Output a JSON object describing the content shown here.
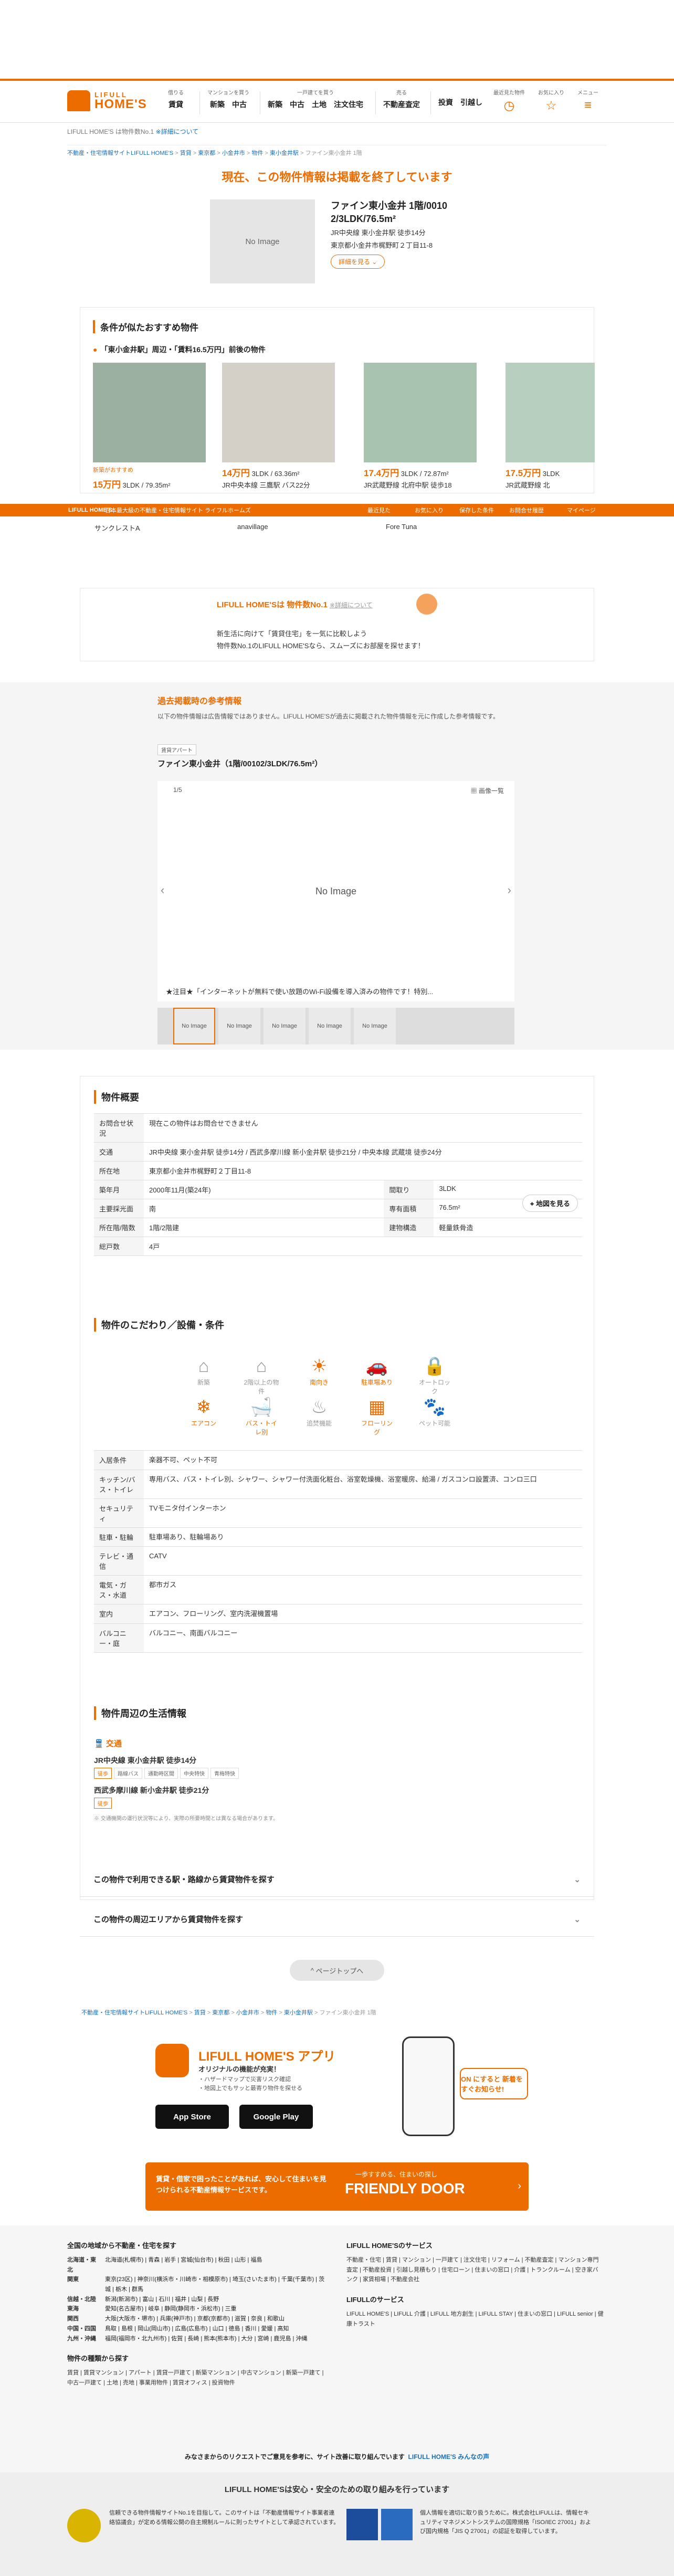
{
  "header": {
    "logo_top": "LIFULL",
    "logo_bottom": "HOME'S",
    "nav": [
      {
        "caption": "借りる",
        "links": [
          "賃貸"
        ]
      },
      {
        "caption": "マンションを買う",
        "links": [
          "新築",
          "中古"
        ]
      },
      {
        "caption": "一戸建てを買う",
        "links": [
          "新築",
          "中古",
          "土地",
          "注文住宅"
        ]
      },
      {
        "caption": "売る",
        "links": [
          "不動産査定"
        ]
      },
      {
        "caption": "",
        "links": [
          "投資",
          "引越し"
        ]
      }
    ],
    "right": [
      {
        "caption": "最近見た物件",
        "icon": "◷"
      },
      {
        "caption": "お気に入り",
        "icon": "☆"
      },
      {
        "caption": "メニュー",
        "icon": "≡"
      }
    ]
  },
  "crumb_top": {
    "site": "LIFULL HOME'S は物件数No.1",
    "about": "※詳細について"
  },
  "breadcrumb": [
    "不動産・住宅情報サイトLIFULL HOME'S",
    "賃貸",
    "東京都",
    "小金井市",
    "物件",
    "東小金井駅",
    "ファイン東小金井 1階"
  ],
  "ended": {
    "message": "現在、この物件情報は掲載を終了しています",
    "noimage": "No Image",
    "title": "ファイン東小金井 1階/0010 2/3LDK/76.5m²",
    "access": "JR中央線 東小金井駅 徒歩14分",
    "address": "東京都小金井市梶野町２丁目11-8",
    "detail_button": "詳細を見る"
  },
  "recommend": {
    "heading": "条件が似たおすすめ物件",
    "subheading": "「東小金井駅」周辺・「賃料16.5万円」前後の物件",
    "cards": [
      {
        "badge": "新築がおすすめ",
        "price": "15万円",
        "spec": "3LDK / 79.35m²",
        "station": "サンクレストA"
      },
      {
        "price": "14万円",
        "spec": "3LDK / 63.36m²",
        "station": "JR中央本線 三鷹駅 バス22分",
        "name": "anavillage"
      },
      {
        "price": "17.4万円",
        "spec": "3LDK / 72.87m²",
        "station": "JR武蔵野線 北府中駅 徒歩18",
        "name": "Fore Tuna"
      },
      {
        "price": "17.5万円",
        "spec": "3LDK",
        "station": "JR武蔵野線 北"
      }
    ]
  },
  "sticky_bar": {
    "brand": "LIFULL HOME'S",
    "tagline": "日本最大級の不動産・住宅情報サイト ライフルホームズ",
    "links": [
      "最近見た",
      "お気に入り",
      "保存した条件",
      "お問合せ履歴",
      "マイページ"
    ]
  },
  "no1": {
    "banner": "LIFULL HOME'Sは 物件数No.1",
    "banner_note": "※詳細について",
    "line1": "新生活に向けて「賃貸住宅」を一気に比較しよう",
    "line2": "物件数No.1のLIFULL HOME'Sなら、スムーズにお部屋を探せます！"
  },
  "history": {
    "heading": "過去掲載時の参考情報",
    "desc": "以下の物件情報は広告情報ではありません。LIFULL HOME'Sが過去に掲載された物件情報を元に作成した参考情報です。",
    "tag": "賃貸アパート",
    "name": "ファイン東小金井（1階/00102/3LDK/76.5m²）",
    "counter": "1/5",
    "all_images": "画像一覧",
    "noimage": "No Image",
    "caption": "★注目★「インターネットが無料で使い放題のWi-Fi設備を導入済みの物件です！特別...",
    "thumbs": [
      "No Image",
      "No Image",
      "No Image",
      "No Image",
      "No Image"
    ]
  },
  "summary": {
    "heading": "物件概要",
    "rows": [
      {
        "k": "お問合せ状況",
        "v": "現在この物件はお問合せできません"
      },
      {
        "k": "交通",
        "v": "JR中央線 東小金井駅 徒歩14分 / 西武多摩川線 新小金井駅 徒歩21分 / 中央本線 武蔵境 徒歩24分"
      },
      {
        "k": "所在地",
        "v": "東京都小金井市梶野町２丁目11-8"
      }
    ],
    "map_button": "地図を見る",
    "grid": [
      {
        "k1": "築年月",
        "v1": "2000年11月(築24年)",
        "k2": "間取り",
        "v2": "3LDK"
      },
      {
        "k1": "主要採光面",
        "v1": "南",
        "k2": "専有面積",
        "v2": "76.5m²"
      },
      {
        "k1": "所在階/階数",
        "v1": "1階/2階建",
        "k2": "建物構造",
        "v2": "軽量鉄骨造"
      },
      {
        "k1": "総戸数",
        "v1": "4戸",
        "k2": "",
        "v2": ""
      }
    ]
  },
  "features": {
    "heading": "物件のこだわり／設備・条件",
    "icons": [
      {
        "label": "新築",
        "glyph": "⌂",
        "on": false
      },
      {
        "label": "2階以上の物件",
        "glyph": "⌂",
        "on": false
      },
      {
        "label": "南向き",
        "glyph": "☀",
        "on": true
      },
      {
        "label": "駐車場あり",
        "glyph": "🚗",
        "on": true
      },
      {
        "label": "オートロック",
        "glyph": "🔒",
        "on": false
      },
      {
        "label": "エアコン",
        "glyph": "❄",
        "on": true
      },
      {
        "label": "バス・トイレ別",
        "glyph": "🛁",
        "on": true
      },
      {
        "label": "追焚機能",
        "glyph": "♨",
        "on": false
      },
      {
        "label": "フローリング",
        "glyph": "▦",
        "on": true
      },
      {
        "label": "ペット可能",
        "glyph": "🐾",
        "on": false
      }
    ],
    "rows": [
      {
        "k": "入居条件",
        "v": "楽器不可、ペット不可"
      },
      {
        "k": "キッチン/バス・トイレ",
        "v": "専用バス、バス・トイレ別、シャワー、シャワー付洗面化粧台、浴室乾燥機、浴室暖房、給湯 / ガスコンロ設置済、コンロ三口"
      },
      {
        "k": "セキュリティ",
        "v": "TVモニタ付インターホン"
      },
      {
        "k": "駐車・駐輪",
        "v": "駐車場あり、駐輪場あり"
      },
      {
        "k": "テレビ・通信",
        "v": "CATV"
      },
      {
        "k": "電気・ガス・水道",
        "v": "都市ガス"
      },
      {
        "k": "室内",
        "v": "エアコン、フローリング、室内洗濯機置場"
      },
      {
        "k": "バルコニー・庭",
        "v": "バルコニー、南面バルコニー"
      }
    ]
  },
  "life": {
    "heading": "物件周辺の生活情報",
    "traffic": "交通",
    "st1": "JR中央線 東小金井駅 徒歩14分",
    "st1_chips": [
      "徒歩",
      "路線バス",
      "通勤時区間",
      "中央特快",
      "青梅特快"
    ],
    "st2": "西武多摩川線 新小金井駅 徒歩21分",
    "st2_chips": [
      "徒歩"
    ],
    "note": "※ 交通機関の運行状況等により、実際の所要時間とは異なる場合があります。"
  },
  "accordions": [
    "この物件で利用できる駅・路線から賃貸物件を探す",
    "この物件の周辺エリアから賃貸物件を探す"
  ],
  "pagetop": "ページトップへ",
  "app": {
    "title": "LIFULL HOME'S アプリ",
    "sub": "オリジナルの機能が充実！",
    "b1": "・ハザードマップで災害リスク確認",
    "b2": "・地図上でもサッと最寄り物件を探せる",
    "ios": "App Store",
    "android": "Google Play",
    "bubble": "ON にすると 新着をすぐお知らせ!"
  },
  "fd": {
    "a": "賃貸・借家で困ったことがあれば、安心して住まいを見つけられる不動産情報サービスです。",
    "b": "一歩すすめる、住まいの探し",
    "c": "FRIENDLY DOOR"
  },
  "footer": {
    "h1": "全国の地域から不動産・住宅を探す",
    "regions": [
      {
        "k": "北海道・東北",
        "v": "北海道(札幌市) | 青森 | 岩手 | 宮城(仙台市) | 秋田 | 山形 | 福島"
      },
      {
        "k": "関東",
        "v": "東京(23区) | 神奈川(横浜市・川崎市・相模原市) | 埼玉(さいたま市) | 千葉(千葉市) | 茨城 | 栃木 | 群馬"
      },
      {
        "k": "信越・北陸",
        "v": "新潟(新潟市) | 富山 | 石川 | 福井 | 山梨 | 長野"
      },
      {
        "k": "東海",
        "v": "愛知(名古屋市) | 岐阜 | 静岡(静岡市・浜松市) | 三重"
      },
      {
        "k": "関西",
        "v": "大阪(大阪市・堺市) | 兵庫(神戸市) | 京都(京都市) | 滋賀 | 奈良 | 和歌山"
      },
      {
        "k": "中国・四国",
        "v": "鳥取 | 島根 | 岡山(岡山市) | 広島(広島市) | 山口 | 徳島 | 香川 | 愛媛 | 高知"
      },
      {
        "k": "九州・沖縄",
        "v": "福岡(福岡市・北九州市) | 佐賀 | 長崎 | 熊本(熊本市) | 大分 | 宮崎 | 鹿児島 | 沖縄"
      }
    ],
    "h2": "物件の種類から探す",
    "kinds": "賃貸 | 賃貸マンション | アパート | 賃貸一戸建て | 新築マンション | 中古マンション | 新築一戸建て | 中古一戸建て | 土地 | 売地 | 事業用物件 | 賃貸オフィス | 投資物件",
    "h3": "LIFULL HOME'Sのサービス",
    "services": "不動産・住宅 | 賃貸 | マンション | 一戸建て | 注文住宅 | リフォーム | 不動産査定 | マンション専門査定 | 不動産投資 | 引越し見積もり | 住宅ローン | 住まいの窓口 | 介護 | トランクルーム | 空き家バンク | 家賃相場 | 不動産会社",
    "h4": "LIFULLのサービス",
    "lifull": "LIFULL HOME'S | LIFULL 介護 | LIFULL 地方創生 | LIFULL STAY | 住まいの窓口 | LIFULL senior | 健康トラスト",
    "msg": "みなさまからのリクエストでご意見を参考に、サイト改善に取り組んでいます",
    "msg_link": "LIFULL HOME'S みんなの声",
    "bottom_title": "LIFULL HOME'Sは安心・安全のための取り組みを行っています",
    "b1": "信頼できる物件情報サイトNo.1を目指して。このサイトは「不動産情報サイト事業者連絡協議会」が定める情報公開の自主規制ルールに則ったサイトとして承認されています。",
    "b2": "個人情報を適切に取り扱うために。株式会社LIFULLは、情報セキュリティマネジメントシステムの国際規格「ISO/IEC 27001」および国内規格「JIS Q 27001」の認証を取得しています。"
  },
  "colors": {
    "accent": "#ec6c00",
    "link": "#1a6fb8"
  }
}
